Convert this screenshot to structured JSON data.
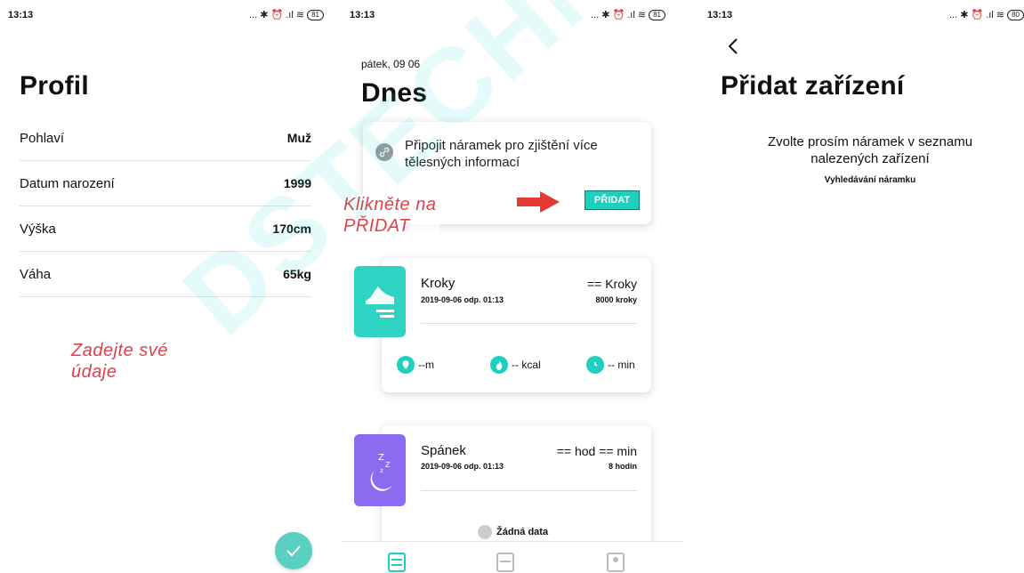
{
  "status": {
    "time": "13:13",
    "icons": "... ✱ ⏰ .ıl ≋",
    "battery_1": "81",
    "battery_2": "81",
    "battery_3": "80"
  },
  "profile": {
    "title": "Profil",
    "rows": [
      {
        "label": "Pohlaví",
        "value": "Muž"
      },
      {
        "label": "Datum narození",
        "value": "1999"
      },
      {
        "label": "Výška",
        "value": "170cm"
      },
      {
        "label": "Váha",
        "value": "65kg"
      }
    ],
    "hint_line1": "Zadejte své",
    "hint_line2": "údaje"
  },
  "today": {
    "date": "pátek, 09 06",
    "title": "Dnes",
    "connect_text_1": "Připojit náramek pro zjištění více",
    "connect_text_2": "tělesných informací",
    "add_label": "PŘIDAT",
    "hint_line1": "Klikněte na",
    "hint_line2": "PŘIDAT",
    "steps": {
      "title": "Kroky",
      "timestamp": "2019-09-06 odp. 01:13",
      "value": "== Kroky",
      "goal": "8000 kroky",
      "distance": "--m",
      "calories": "-- kcal",
      "time": "-- min"
    },
    "sleep": {
      "title": "Spánek",
      "timestamp": "2019-09-06 odp. 01:13",
      "value": "== hod == min",
      "goal": "8 hodin",
      "empty": "Žádná data"
    }
  },
  "add_device": {
    "title": "Přidat zařízení",
    "desc_1": "Zvolte prosím náramek v seznamu",
    "desc_2": "nalezených zařízení",
    "searching": "Vyhledávání náramku"
  },
  "watermark": "DSTECHNIKA",
  "colors": {
    "accent": "#1fcfbe",
    "hint": "#e0414c",
    "sleep": "#8b6cf0",
    "arrow": "#e53935"
  }
}
